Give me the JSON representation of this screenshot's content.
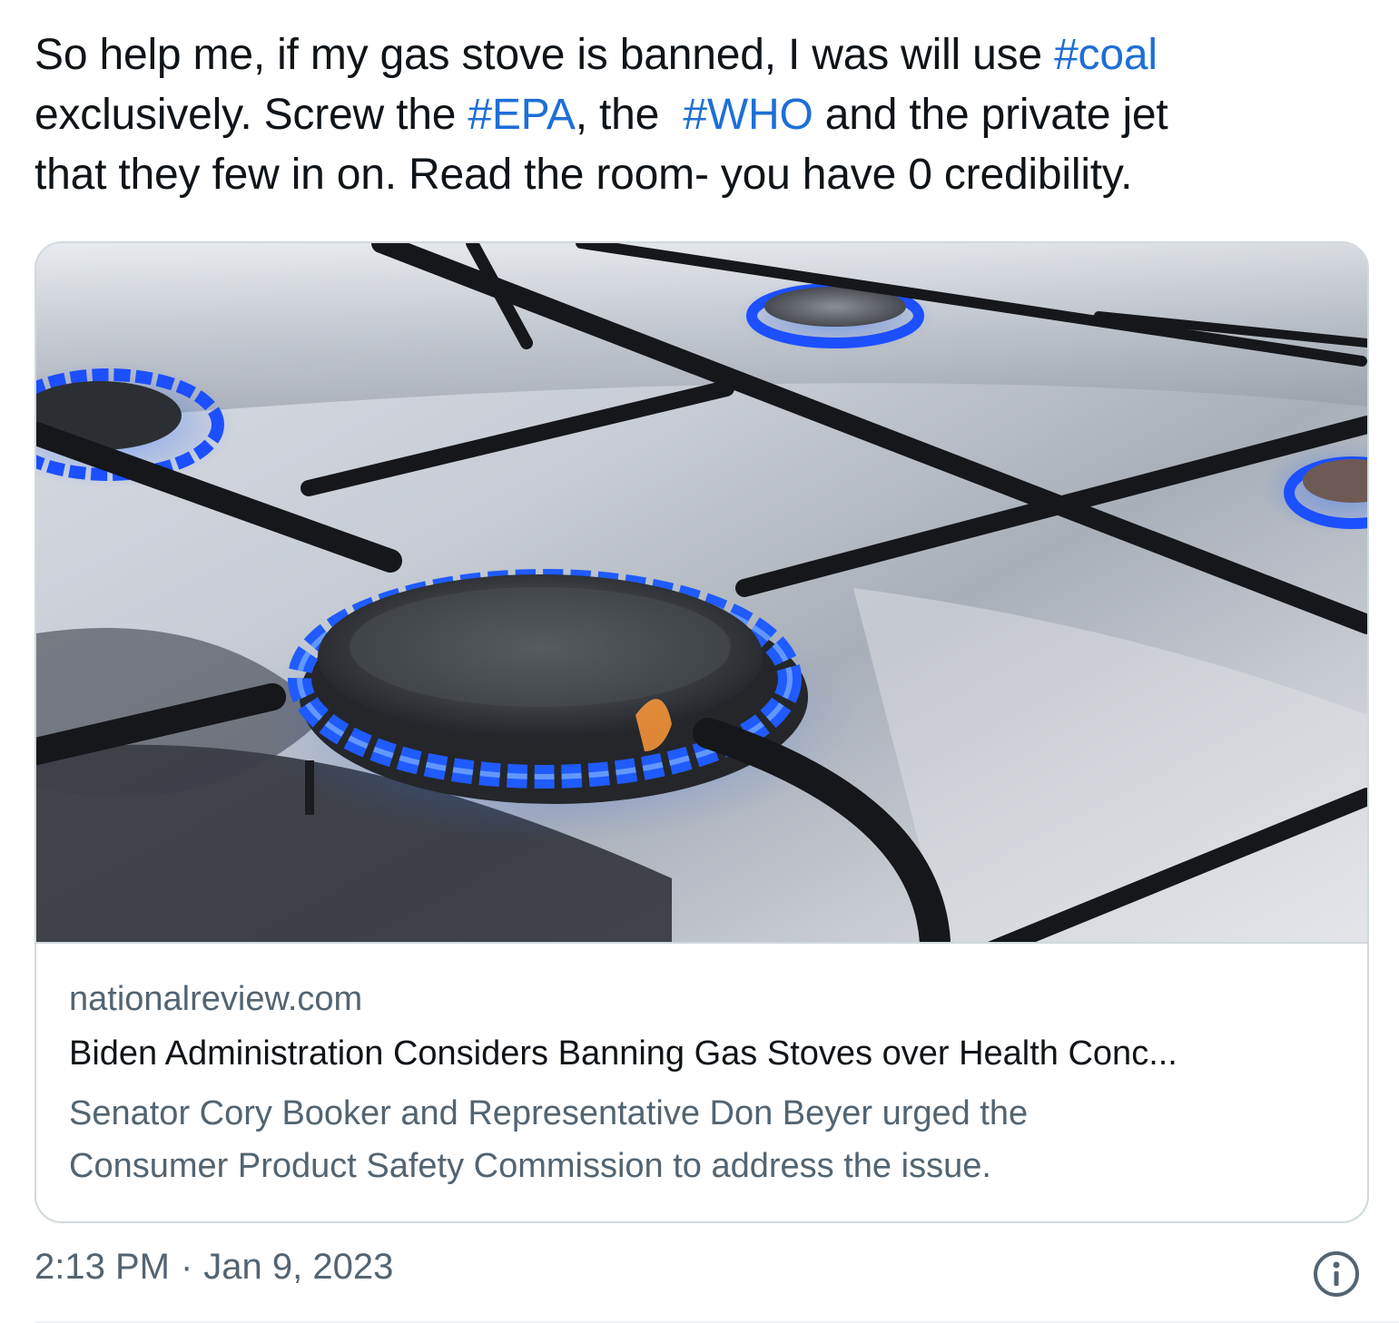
{
  "tweet": {
    "lines": [
      [
        {
          "text": "So help me, if my gas stove is banned, I was will use ",
          "hashtag": false
        },
        {
          "text": "#coal",
          "hashtag": true
        }
      ],
      [
        {
          "text": "exclusively. Screw the ",
          "hashtag": false
        },
        {
          "text": "#EPA",
          "hashtag": true
        },
        {
          "text": ", the  ",
          "hashtag": false
        },
        {
          "text": "#WHO",
          "hashtag": true
        },
        {
          "text": " and the private jet",
          "hashtag": false
        }
      ],
      [
        {
          "text": "that they few in on. Read the room- you have 0 credibility.",
          "hashtag": false
        }
      ]
    ]
  },
  "card": {
    "image_icon": "gas-stove-burner-photo",
    "domain": "nationalreview.com",
    "title": "Biden Administration Considers Banning Gas Stoves over Health Conc...",
    "description_lines": [
      "Senator Cory Booker and Representative Don Beyer urged the",
      "Consumer Product Safety Commission to address the issue."
    ]
  },
  "meta": {
    "time": "2:13 PM",
    "separator": "·",
    "date": "Jan 9, 2023",
    "info_icon": "info-icon"
  },
  "colors": {
    "text": "#0f1419",
    "secondary": "#536471",
    "hashtag": "#1d6fd6",
    "border": "#cfd9de",
    "flame": "#1f5bff"
  }
}
